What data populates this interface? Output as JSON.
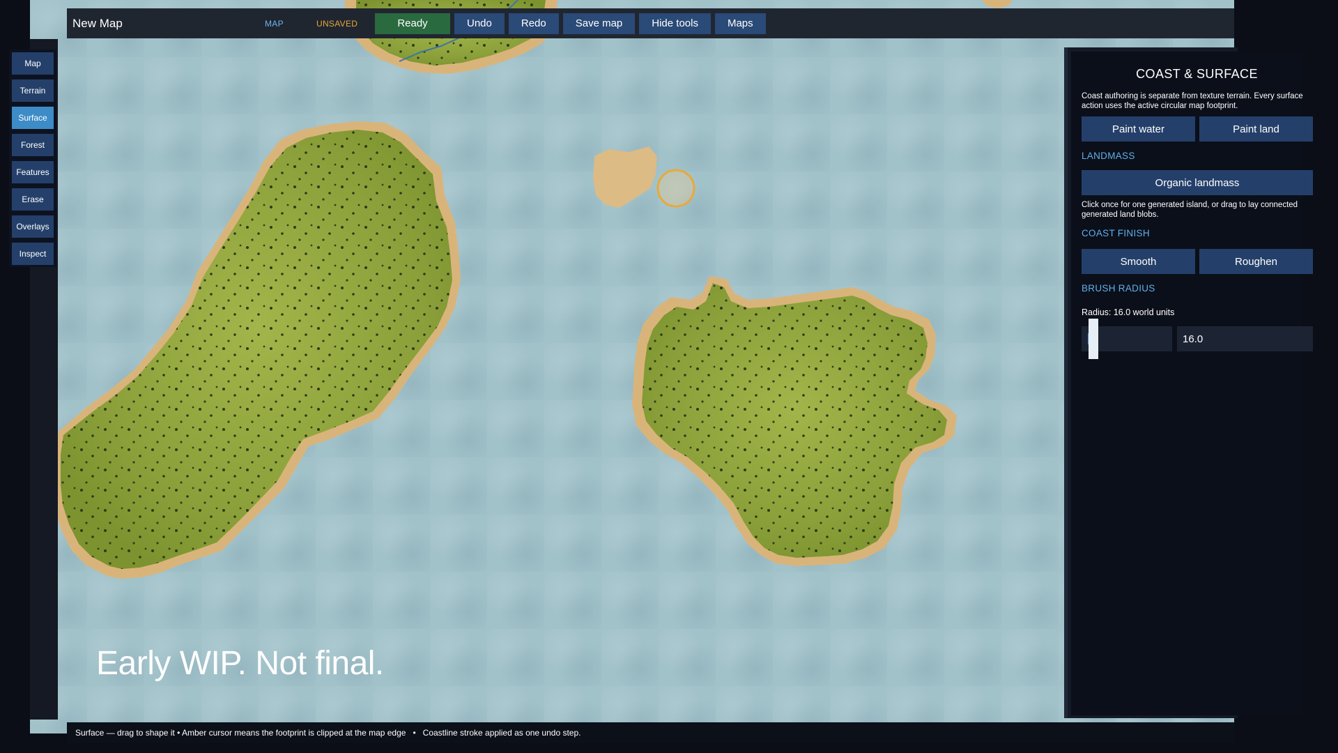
{
  "topbar": {
    "title": "New Map",
    "mode_tag": "MAP",
    "save_state": "UNSAVED",
    "buttons": {
      "ready": "Ready",
      "undo": "Undo",
      "redo": "Redo",
      "save": "Save map",
      "hide_tools": "Hide tools",
      "maps": "Maps"
    }
  },
  "leftnav": {
    "items": [
      "Map",
      "Terrain",
      "Surface",
      "Forest",
      "Features",
      "Erase",
      "Overlays",
      "Inspect"
    ],
    "active": "Surface"
  },
  "panel": {
    "title": "COAST & SURFACE",
    "description": "Coast authoring is separate from texture terrain. Every surface action uses the active circular map footprint.",
    "paint_water": "Paint water",
    "paint_land": "Paint land",
    "landmass_heading": "LANDMASS",
    "organic_landmass": "Organic landmass",
    "landmass_help": "Click once for one generated island, or drag to lay connected generated land blobs.",
    "coast_finish_heading": "COAST FINISH",
    "smooth": "Smooth",
    "roughen": "Roughen",
    "brush_radius_heading": "BRUSH RADIUS",
    "radius_label": "Radius: 16.0 world units",
    "radius_value": "16.0",
    "radius_fraction": 0.08
  },
  "statusbar": {
    "text": "Surface — drag to shape it • Amber cursor means the footprint is clipped at the map edge   •   Coastline stroke applied as one undo step."
  },
  "watermark": "Early WIP. Not final.",
  "colors": {
    "water": "#a2c2ca",
    "grass": "#8fa53a",
    "sand": "#d9b47a",
    "accent": "#3d8cc7",
    "ready": "#2a6a3f",
    "unsaved": "#e7a83c",
    "cursor": "#e8a93a"
  }
}
